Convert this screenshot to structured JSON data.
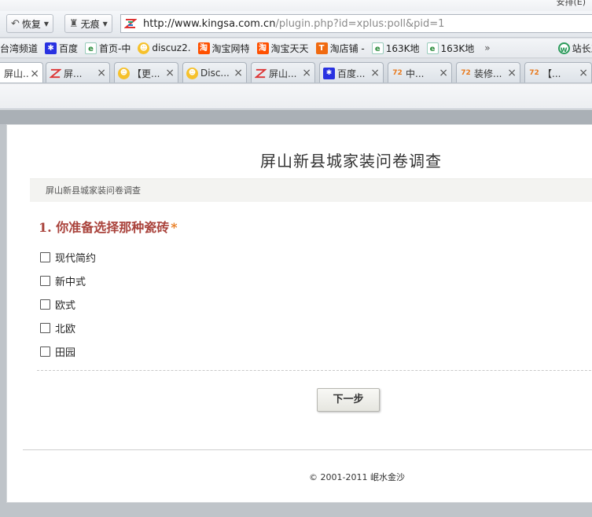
{
  "topstrip": {
    "peek_text": "安排(E)"
  },
  "navbar": {
    "restore_label": "恢复",
    "incognito_label": "无痕",
    "url_host": "http://www.kingsa.com.cn",
    "url_path": "/plugin.php?id=xplus:poll&pid=1"
  },
  "bookmarks": {
    "items": [
      {
        "label": "台湾频道",
        "icon": "none"
      },
      {
        "label": "百度",
        "icon": "baidu-icon"
      },
      {
        "label": "首页-中",
        "icon": "ie-page-icon"
      },
      {
        "label": "discuz2.",
        "icon": "discuz-icon"
      },
      {
        "label": "淘宝网特",
        "icon": "taobao-icon"
      },
      {
        "label": "淘宝天天",
        "icon": "taobao-icon"
      },
      {
        "label": "淘店铺 -",
        "icon": "tdianpu-icon"
      },
      {
        "label": "163K地",
        "icon": "ie-page-icon"
      },
      {
        "label": "163K地",
        "icon": "ie-page-icon"
      }
    ],
    "more": "»",
    "right_label": "站长工"
  },
  "tabs": [
    {
      "label": "屏山...",
      "icon": "none",
      "active": true
    },
    {
      "label": "屏...",
      "icon": "site-icon"
    },
    {
      "label": "【更...",
      "icon": "discuz-icon"
    },
    {
      "label": "Disc...",
      "icon": "discuz-icon"
    },
    {
      "label": "屏山...",
      "icon": "site-icon"
    },
    {
      "label": "百度...",
      "icon": "baidu-icon"
    },
    {
      "label": "中...",
      "icon": "zhuang-icon"
    },
    {
      "label": "装修...",
      "icon": "zhuang-icon"
    },
    {
      "label": "【...",
      "icon": "zhuang-icon"
    }
  ],
  "page": {
    "title": "屏山新县城家装问卷调查",
    "breadcrumb": "屏山新县城家装问卷调查",
    "question": {
      "label": "1. 你准备选择那种瓷砖",
      "required_mark": "*"
    },
    "options": [
      "现代简约",
      "新中式",
      "欧式",
      "北欧",
      "田园"
    ],
    "next_button": "下一步",
    "footer": "© 2001-2011 岷水金沙"
  },
  "colors": {
    "question": "#a9423b",
    "required": "#e8791d",
    "baidu": "#2932e1",
    "taobao": "#ff5000"
  }
}
